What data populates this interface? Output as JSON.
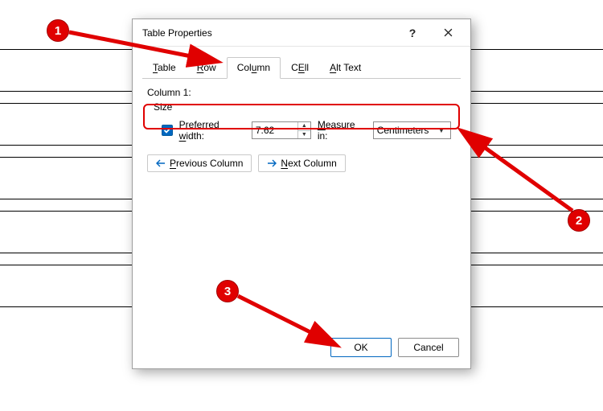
{
  "dialog": {
    "title": "Table Properties",
    "tabs": {
      "table": "Table",
      "row": "Row",
      "column": "Column",
      "cell": "Cell",
      "alt_text": "Alt Text",
      "table_accel": "T",
      "row_accel": "R",
      "column_accel": "u",
      "cell_accel": "E",
      "alt_accel": "A"
    },
    "column_label": "Column 1:",
    "size_label": "Size",
    "preferred_width_label": "Preferred width:",
    "preferred_width_accel": "w",
    "width_value": "7.62",
    "measure_label": "Measure in:",
    "measure_accel": "M",
    "measure_value": "Centimeters",
    "prev_btn": "Previous Column",
    "prev_accel": "P",
    "next_btn": "Next Column",
    "next_accel": "N",
    "ok": "OK",
    "cancel": "Cancel"
  },
  "annotations": {
    "m1": "1",
    "m2": "2",
    "m3": "3"
  }
}
